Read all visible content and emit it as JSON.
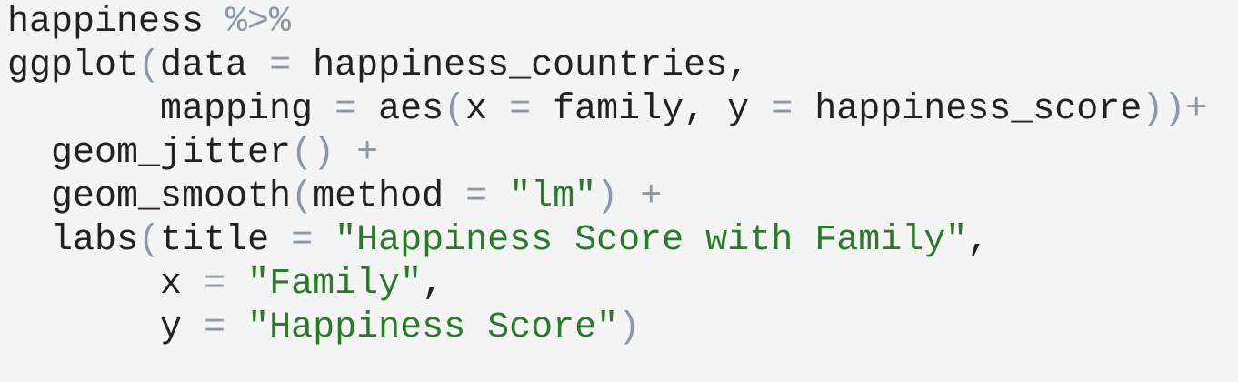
{
  "code": {
    "lines": [
      [
        {
          "t": "happiness ",
          "k": "id"
        },
        {
          "t": "%>%",
          "k": "op"
        }
      ],
      [
        {
          "t": "ggplot",
          "k": "id"
        },
        {
          "t": "(",
          "k": "op"
        },
        {
          "t": "data ",
          "k": "id"
        },
        {
          "t": "=",
          "k": "op"
        },
        {
          "t": " happiness_countries,",
          "k": "id"
        }
      ],
      [
        {
          "t": "       mapping ",
          "k": "id"
        },
        {
          "t": "=",
          "k": "op"
        },
        {
          "t": " aes",
          "k": "id"
        },
        {
          "t": "(",
          "k": "op"
        },
        {
          "t": "x ",
          "k": "id"
        },
        {
          "t": "=",
          "k": "op"
        },
        {
          "t": " family, y ",
          "k": "id"
        },
        {
          "t": "=",
          "k": "op"
        },
        {
          "t": " happiness_score",
          "k": "id"
        },
        {
          "t": "))+",
          "k": "op"
        }
      ],
      [
        {
          "t": "  geom_jitter",
          "k": "id"
        },
        {
          "t": "()",
          "k": "op"
        },
        {
          "t": " ",
          "k": "id"
        },
        {
          "t": "+",
          "k": "op"
        }
      ],
      [
        {
          "t": "  geom_smooth",
          "k": "id"
        },
        {
          "t": "(",
          "k": "op"
        },
        {
          "t": "method ",
          "k": "id"
        },
        {
          "t": "=",
          "k": "op"
        },
        {
          "t": " ",
          "k": "id"
        },
        {
          "t": "\"lm\"",
          "k": "str"
        },
        {
          "t": ")",
          "k": "op"
        },
        {
          "t": " ",
          "k": "id"
        },
        {
          "t": "+",
          "k": "op"
        }
      ],
      [
        {
          "t": "  labs",
          "k": "id"
        },
        {
          "t": "(",
          "k": "op"
        },
        {
          "t": "title ",
          "k": "id"
        },
        {
          "t": "=",
          "k": "op"
        },
        {
          "t": " ",
          "k": "id"
        },
        {
          "t": "\"Happiness Score with Family\"",
          "k": "str"
        },
        {
          "t": ",",
          "k": "id"
        }
      ],
      [
        {
          "t": "       x ",
          "k": "id"
        },
        {
          "t": "=",
          "k": "op"
        },
        {
          "t": " ",
          "k": "id"
        },
        {
          "t": "\"Family\"",
          "k": "str"
        },
        {
          "t": ",",
          "k": "id"
        }
      ],
      [
        {
          "t": "       y ",
          "k": "id"
        },
        {
          "t": "=",
          "k": "op"
        },
        {
          "t": " ",
          "k": "id"
        },
        {
          "t": "\"Happiness Score\"",
          "k": "str"
        },
        {
          "t": ")",
          "k": "op"
        }
      ]
    ]
  }
}
